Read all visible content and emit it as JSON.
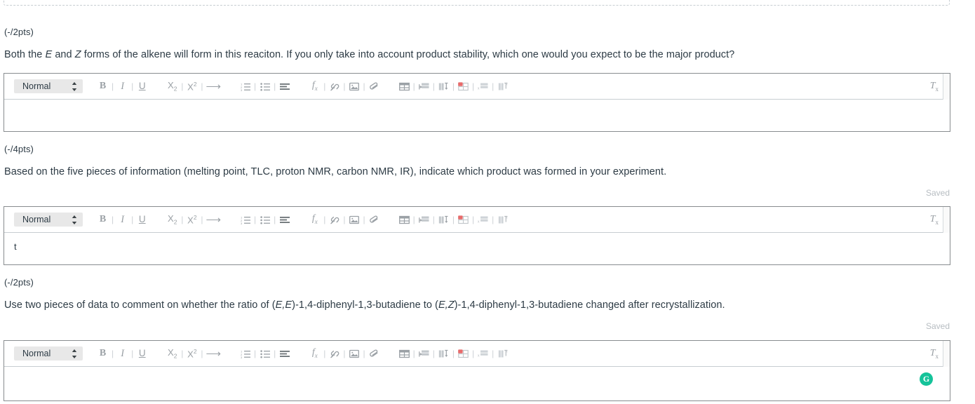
{
  "page": {
    "background": "#ffffff",
    "text_color": "#2d3b45",
    "border_color": "#888c8f",
    "muted_color": "#b7bdc2",
    "accent_green": "#15c39a",
    "accent_red": "#e86a6a"
  },
  "toolbar": {
    "style_label": "Normal",
    "bold_label": "B",
    "italic_label": "I",
    "underline_label": "U",
    "subscript_label": "X",
    "subscript_index": "2",
    "superscript_label": "X",
    "superscript_index": "2",
    "arrow_label": "⟶",
    "equation_label": "f",
    "equation_index": "x",
    "clear_format_label": "T",
    "clear_format_index": "x",
    "separator": "|",
    "icons": [
      "numbered-list-icon",
      "bulleted-list-icon",
      "align-icon",
      "equation-icon",
      "link-icon",
      "image-icon",
      "attachment-icon",
      "table-icon",
      "table-row-icon",
      "table-column-icon",
      "table-cell-icon",
      "table-delete-row-icon",
      "table-delete-column-icon"
    ]
  },
  "questions": [
    {
      "points": "(-/2pts)",
      "prompt_parts": [
        {
          "text": "Both the ",
          "italic": false
        },
        {
          "text": "E",
          "italic": true
        },
        {
          "text": " and ",
          "italic": false
        },
        {
          "text": "Z",
          "italic": true
        },
        {
          "text": " forms of the alkene will form in this reaciton. If you only take into account product stability, which one would you expect to be the major product?",
          "italic": false
        }
      ],
      "saved_label": "",
      "answer_value": "",
      "has_grammarly": false
    },
    {
      "points": "(-/4pts)",
      "prompt_parts": [
        {
          "text": "Based on the five pieces of information (melting point, TLC, proton NMR, carbon NMR, IR), indicate which product was formed in your experiment.",
          "italic": false
        }
      ],
      "saved_label": "Saved",
      "answer_value": "t",
      "has_grammarly": false
    },
    {
      "points": "(-/2pts)",
      "prompt_parts": [
        {
          "text": "Use two pieces of data to comment on whether the ratio of (",
          "italic": false
        },
        {
          "text": "E,E",
          "italic": true
        },
        {
          "text": ")-1,4-diphenyl-1,3-butadiene to (",
          "italic": false
        },
        {
          "text": "E,Z",
          "italic": true
        },
        {
          "text": ")-1,4-diphenyl-1,3-butadiene changed after recrystallization.",
          "italic": false
        }
      ],
      "saved_label": "Saved",
      "answer_value": "",
      "has_grammarly": true,
      "grammarly_label": "G"
    }
  ]
}
